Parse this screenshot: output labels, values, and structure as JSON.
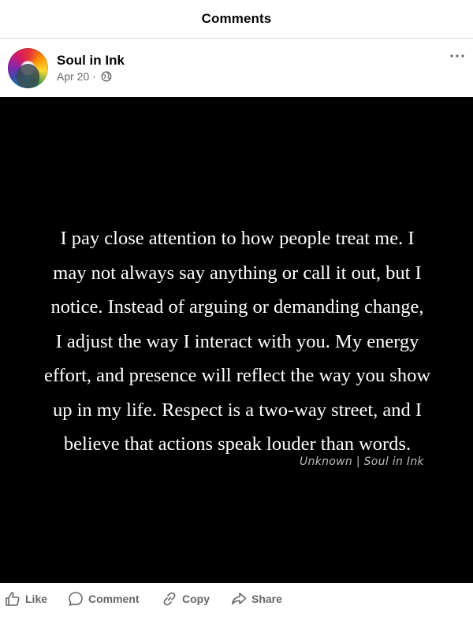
{
  "header": {
    "title": "Comments"
  },
  "post": {
    "author": "Soul in Ink",
    "date": "Apr 20 ·",
    "privacy_icon": "globe-icon",
    "menu_icon": "more-icon",
    "quote_text": "I pay close attention to how people treat me. I\nmay not always say anything or call it out, but I\nnotice. Instead of arguing or demanding change,\nI adjust the way I interact with you. My energy\neffort, and presence will reflect the way you show\nup in my life. Respect is a two-way street, and I\nbelieve that actions speak louder than words.",
    "signature": "Unknown | Soul in Ink"
  },
  "actions": {
    "like": "Like",
    "comment": "Comment",
    "copy": "Copy",
    "share": "Share"
  },
  "colors": {
    "muted_text": "#65676b",
    "image_bg": "#000000",
    "divider": "#dcdde1"
  }
}
